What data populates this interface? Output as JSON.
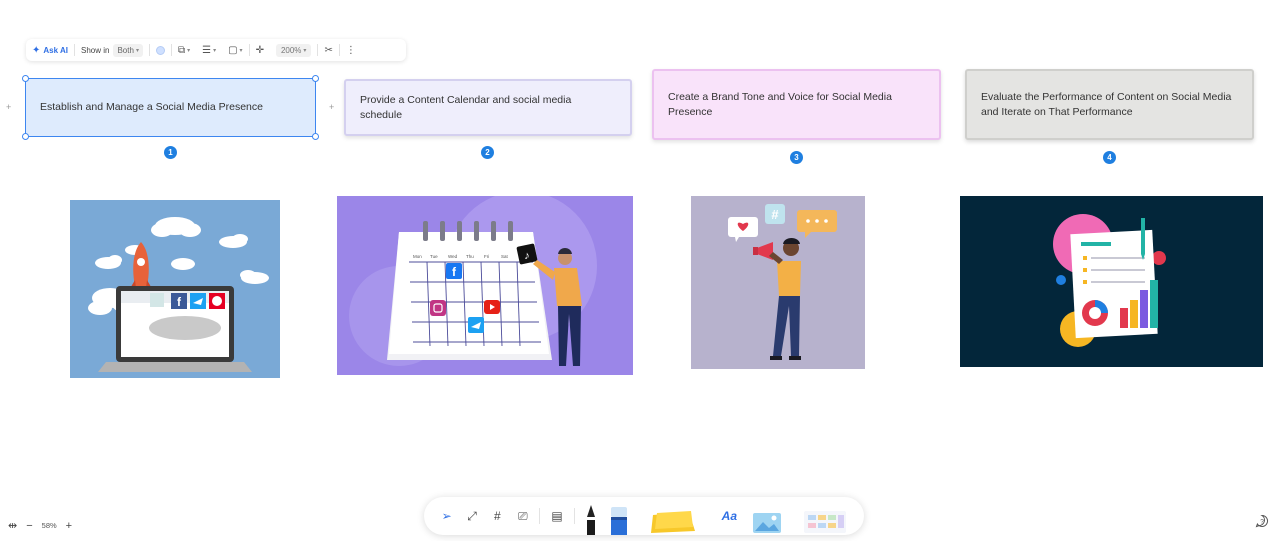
{
  "toolbar": {
    "ask_ai": "Ask AI",
    "show_in_label": "Show in",
    "show_in_value": "Both",
    "zoom": "200%"
  },
  "steps": [
    {
      "text": "Establish and Manage a Social Media Presence",
      "number": "1"
    },
    {
      "text": "Provide a Content Calendar and social media schedule",
      "number": "2"
    },
    {
      "text": "Create a Brand Tone and Voice for Social Media Presence",
      "number": "3"
    },
    {
      "text": "Evaluate the Performance of Content on Social Media and Iterate on That Performance",
      "number": "4"
    }
  ],
  "calendar": {
    "days": [
      "Mon",
      "Tue",
      "Wed",
      "Thu",
      "Fri",
      "Sat"
    ]
  },
  "zoom_control": {
    "percent": "58%"
  },
  "colors": {
    "accent": "#3d86f0",
    "badge": "#1f7fe0",
    "card1": "#deebfd",
    "card2": "#efeefc",
    "card3": "#f9e3fa",
    "card4": "#e4e4e2"
  },
  "icons": [
    "sparkle-icon",
    "chevron-down-icon",
    "duplicate-icon",
    "align-icon",
    "shape-icon",
    "crosshair-icon",
    "scissors-icon",
    "more-icon",
    "pointer-icon",
    "connector-icon",
    "frame-icon",
    "presentation-icon",
    "note-icon",
    "pen-icon",
    "marker-icon",
    "sticky-note-icon",
    "text-icon",
    "image-icon",
    "template-icon",
    "help-icon",
    "fit-icon",
    "minus-icon",
    "plus-icon"
  ]
}
